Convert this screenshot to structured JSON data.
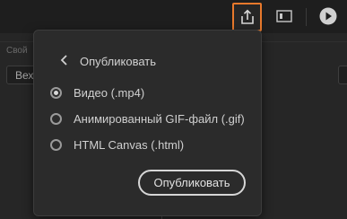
{
  "colors": {
    "accent": "#e8792c",
    "background": "#1e1e1e",
    "popover_bg": "#2b2b2b"
  },
  "toolbar": {
    "share_icon": "share-export-icon",
    "preview_icon": "screen-preview-icon",
    "play_icon": "play-icon"
  },
  "background_panel": {
    "section_label": "Свой",
    "select_value": "Вех"
  },
  "popover": {
    "back_icon": "chevron-left-icon",
    "title": "Опубликовать",
    "options": [
      {
        "label": "Видео (.mp4)",
        "selected": true
      },
      {
        "label": "Анимированный GIF-файл (.gif)",
        "selected": false
      },
      {
        "label": "HTML Canvas (.html)",
        "selected": false
      }
    ],
    "publish_label": "Опубликовать"
  }
}
